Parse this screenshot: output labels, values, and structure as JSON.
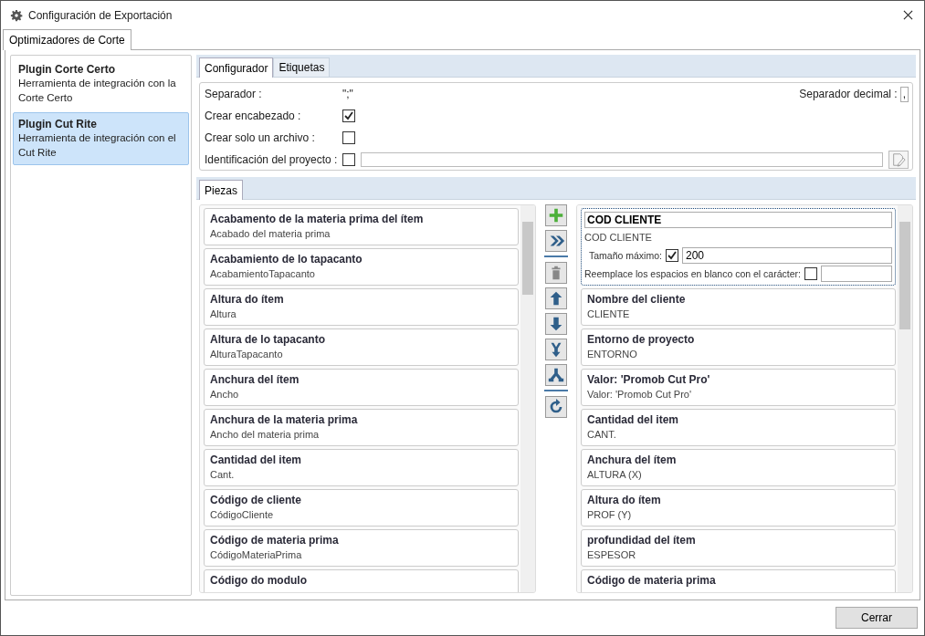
{
  "window": {
    "title": "Configuración de Exportación"
  },
  "outer_tabs": [
    {
      "label": "Optimizadores de Corte",
      "selected": true
    }
  ],
  "sidebar": {
    "items": [
      {
        "title": "Plugin Corte Certo",
        "description": "Herramienta de integración con la Corte Certo",
        "selected": false
      },
      {
        "title": "Plugin Cut Rite",
        "description": "Herramienta de integración con el Cut Rite",
        "selected": true
      }
    ]
  },
  "config_tabs": [
    {
      "label": "Configurador",
      "selected": true
    },
    {
      "label": "Etiquetas",
      "selected": false
    }
  ],
  "config": {
    "separator": {
      "label": "Separador :",
      "value": "\";\""
    },
    "decimal_separator": {
      "label": "Separador decimal :",
      "value": ","
    },
    "create_header": {
      "label": "Crear encabezado :",
      "checked": true
    },
    "single_file": {
      "label": "Crear solo un archivo :",
      "checked": false
    },
    "project_id": {
      "label": "Identificación del proyecto :",
      "checked": false
    }
  },
  "pieces_tabs": [
    {
      "label": "Piezas",
      "selected": true
    }
  ],
  "available_fields": [
    {
      "title": "Acabamento de la materia prima del ítem",
      "subtitle": "Acabado del materia prima"
    },
    {
      "title": "Acabamiento de lo tapacanto",
      "subtitle": "AcabamientoTapacanto"
    },
    {
      "title": "Altura do ítem",
      "subtitle": "Altura"
    },
    {
      "title": "Altura de lo tapacanto",
      "subtitle": "AlturaTapacanto"
    },
    {
      "title": "Anchura del ítem",
      "subtitle": "Ancho"
    },
    {
      "title": "Anchura de la materia prima",
      "subtitle": "Ancho del materia prima"
    },
    {
      "title": "Cantidad del item",
      "subtitle": "Cant."
    },
    {
      "title": "Código de cliente",
      "subtitle": "CódigoCliente"
    },
    {
      "title": "Código de materia prima",
      "subtitle": "CódigoMateriaPrima"
    },
    {
      "title": "Código do modulo"
    }
  ],
  "toolbar": [
    {
      "kind": "add",
      "disabled": false
    },
    {
      "kind": "add-all",
      "disabled": false
    },
    {
      "kind": "divider"
    },
    {
      "kind": "delete",
      "disabled": true
    },
    {
      "kind": "up",
      "disabled": false
    },
    {
      "kind": "down",
      "disabled": false
    },
    {
      "kind": "merge",
      "disabled": false
    },
    {
      "kind": "split",
      "disabled": false
    },
    {
      "kind": "divider"
    },
    {
      "kind": "refresh",
      "disabled": false
    }
  ],
  "export_fields": [
    {
      "kind": "editing",
      "title": "COD CLIENTE",
      "subtitle": "COD CLIENTE",
      "max_size": {
        "label": "Tamaño máximo:",
        "checked": true,
        "value": "200"
      },
      "replace_spaces": {
        "label": "Reemplace los espacios en blanco con el carácter:",
        "checked": false
      }
    },
    {
      "kind": "field",
      "title": "Nombre del cliente",
      "subtitle": "CLIENTE"
    },
    {
      "kind": "field",
      "title": "Entorno de proyecto",
      "subtitle": "ENTORNO"
    },
    {
      "kind": "field",
      "title": "Valor: 'Promob Cut Pro'",
      "subtitle": "Valor: 'Promob Cut Pro'"
    },
    {
      "kind": "field",
      "title": "Cantidad del item",
      "subtitle": "CANT."
    },
    {
      "kind": "field",
      "title": "Anchura del ítem",
      "subtitle": "ALTURA (X)"
    },
    {
      "kind": "field",
      "title": "Altura do ítem",
      "subtitle": "PROF (Y)"
    },
    {
      "kind": "field",
      "title": "profundidad del ítem",
      "subtitle": "ESPESOR"
    },
    {
      "kind": "field",
      "title": "Código de materia prima"
    }
  ],
  "buttons": [
    {
      "label": "Cerrar"
    }
  ]
}
